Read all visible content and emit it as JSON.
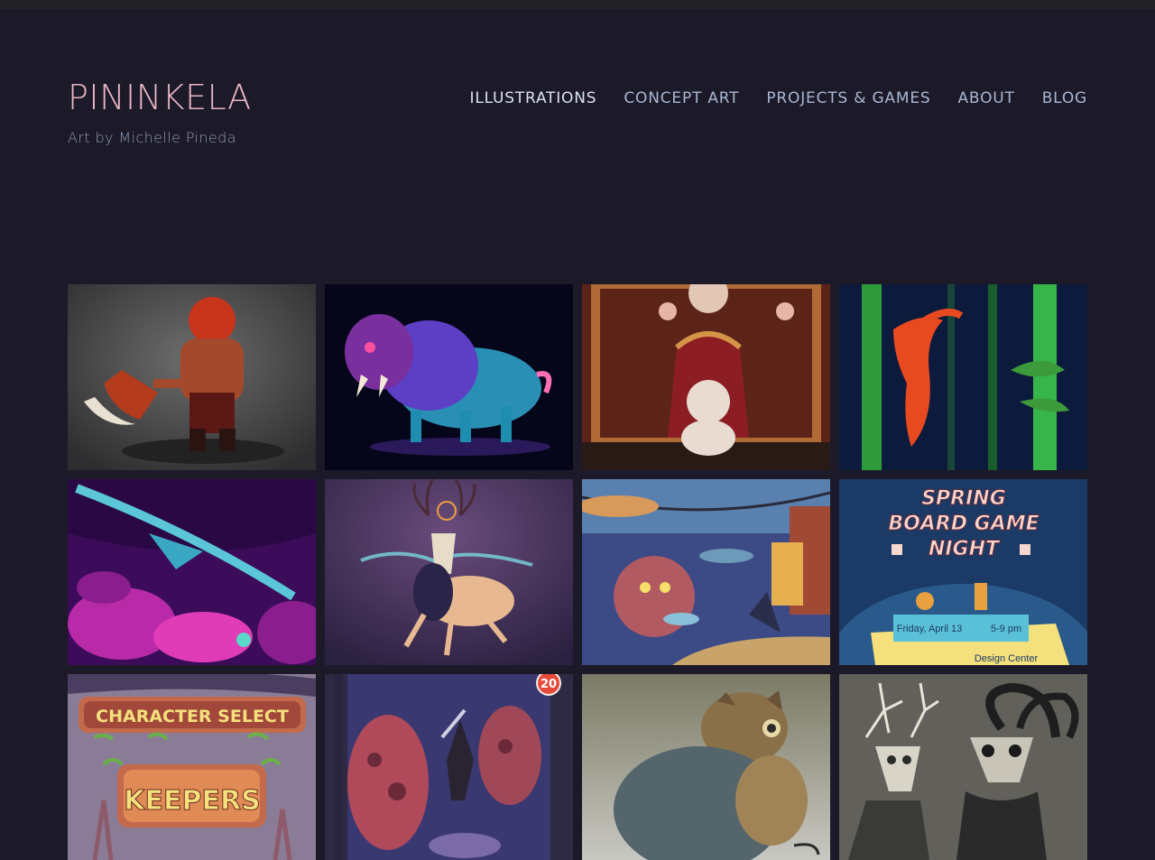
{
  "site": {
    "title": "PININKELA",
    "tagline": "Art by Michelle Pineda"
  },
  "nav": {
    "items": [
      {
        "label": "ILLUSTRATIONS",
        "active": true
      },
      {
        "label": "CONCEPT ART",
        "active": false
      },
      {
        "label": "PROJECTS & GAMES",
        "active": false
      },
      {
        "label": "ABOUT",
        "active": false
      },
      {
        "label": "BLOG",
        "active": false
      }
    ]
  },
  "gallery": {
    "items": [
      {
        "name": "warrior-axe-artwork"
      },
      {
        "name": "neon-boar-artwork"
      },
      {
        "name": "poodle-throne-artwork"
      },
      {
        "name": "bamboo-lizard-artwork"
      },
      {
        "name": "neon-bird-leaves-artwork"
      },
      {
        "name": "spirit-stag-artwork"
      },
      {
        "name": "mushroom-forest-creature-artwork"
      },
      {
        "name": "board-game-poster-artwork",
        "text": {
          "line1": "SPRING",
          "line2": "BOARD GAME",
          "line3": "NIGHT",
          "date": "Friday, April 13",
          "time": "5-9 pm",
          "venue": "Design Center"
        }
      },
      {
        "name": "character-select-artwork",
        "text": {
          "line1": "CHARACTER SELECT",
          "line2": "KEEPERS"
        }
      },
      {
        "name": "knight-creatures-card-artwork",
        "text": {
          "badge": "20"
        }
      },
      {
        "name": "bear-creature-artwork"
      },
      {
        "name": "antlered-goat-skull-artwork"
      }
    ]
  }
}
